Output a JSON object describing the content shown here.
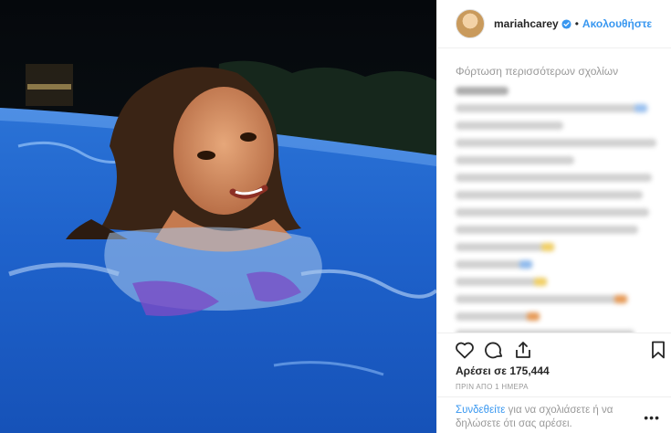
{
  "post": {
    "username": "mariahcarey",
    "separator": "•",
    "follow_label": "Ακολουθήστε"
  },
  "comments": {
    "load_more_label": "Φόρτωση περισσότερων σχολίων"
  },
  "stats": {
    "likes_label": "Αρέσει σε 175,444",
    "timestamp": "ΠΡΙΝ ΑΠΟ 1 ΗΜΕΡΑ"
  },
  "login_prompt": {
    "link_text": "Συνδεθείτε",
    "rest_text": " για να σχολιάσετε ή να δηλώσετε ότι σας αρέσει."
  },
  "more_options": "•••",
  "colors": {
    "link_blue": "#3897f0",
    "text_dark": "#262626",
    "text_grey": "#999999",
    "verified_blue": "#3897f0"
  },
  "icons": {
    "like": "heart-icon",
    "comment": "comment-bubble-icon",
    "share": "share-icon",
    "save": "bookmark-icon",
    "verified": "verified-badge-icon"
  }
}
